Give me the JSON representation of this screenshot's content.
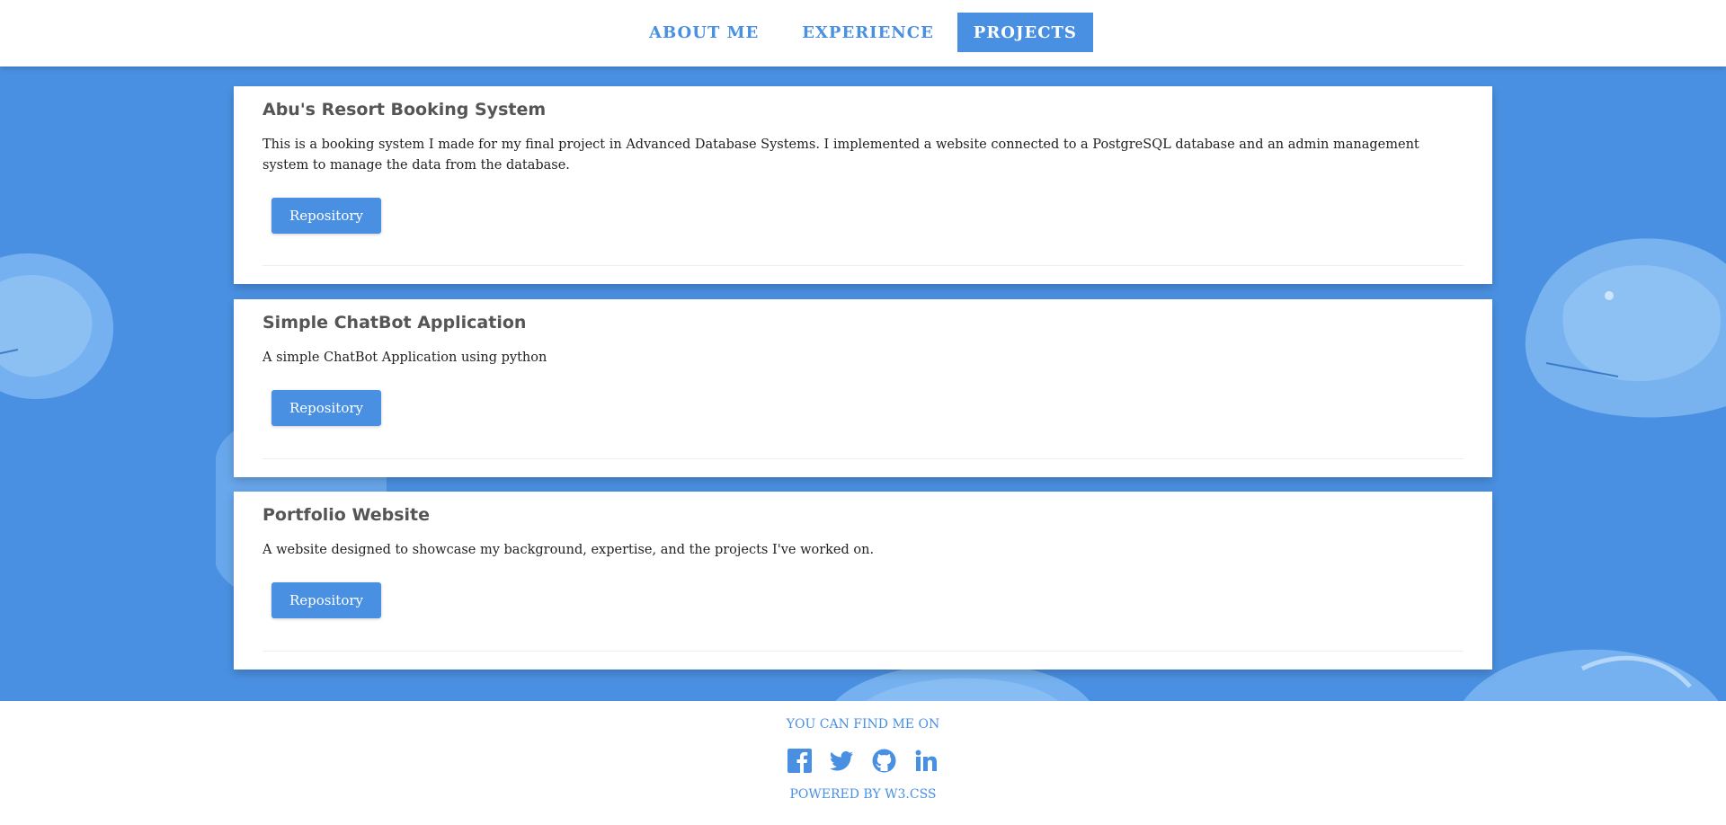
{
  "nav": {
    "items": [
      {
        "label": "ABOUT ME",
        "active": false
      },
      {
        "label": "EXPERIENCE",
        "active": false
      },
      {
        "label": "PROJECTS",
        "active": true
      }
    ]
  },
  "projects": [
    {
      "title": "Abu's Resort Booking System",
      "description": "This is a booking system I made for my final project in Advanced Database Systems. I implemented a website connected to a PostgreSQL database and an admin management system to manage the data from the database.",
      "button_label": "Repository"
    },
    {
      "title": "Simple ChatBot Application",
      "description": "A simple ChatBot Application using python",
      "button_label": "Repository"
    },
    {
      "title": "Portfolio Website",
      "description": "A website designed to showcase my background, expertise, and the projects I've worked on.",
      "button_label": "Repository"
    }
  ],
  "footer": {
    "find_me": "YOU CAN FIND ME ON",
    "social_icons": [
      "facebook-icon",
      "twitter-icon",
      "github-icon",
      "linkedin-icon"
    ],
    "powered_by": "POWERED BY W3.CSS"
  },
  "colors": {
    "accent": "#4a90e2",
    "background": "#4a90e2",
    "card": "#ffffff"
  }
}
